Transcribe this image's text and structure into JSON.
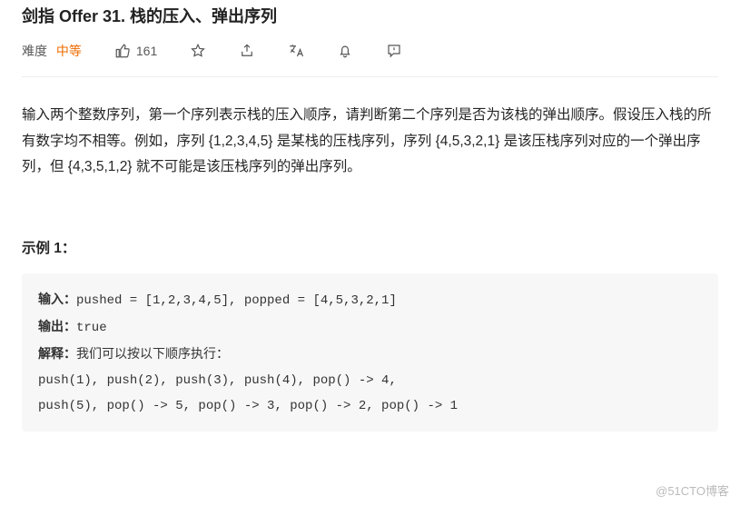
{
  "title": "剑指 Offer 31. 栈的压入、弹出序列",
  "meta": {
    "difficultyLabel": "难度",
    "difficultyValue": "中等",
    "likes": "161"
  },
  "description": "输入两个整数序列，第一个序列表示栈的压入顺序，请判断第二个序列是否为该栈的弹出顺序。假设压入栈的所有数字均不相等。例如，序列 {1,2,3,4,5} 是某栈的压栈序列，序列 {4,5,3,2,1} 是该压栈序列对应的一个弹出序列，但 {4,3,5,1,2} 就不可能是该压栈序列的弹出序列。",
  "example": {
    "heading": "示例 1：",
    "inputLabel": "输入：",
    "inputValue": "pushed = [1,2,3,4,5], popped = [4,5,3,2,1]",
    "outputLabel": "输出：",
    "outputValue": "true",
    "explainLabel": "解释：",
    "explainValue": "我们可以按以下顺序执行：",
    "rest": "push(1), push(2), push(3), push(4), pop() -> 4,\npush(5), pop() -> 5, pop() -> 3, pop() -> 2, pop() -> 1"
  },
  "watermark": "@51CTO博客"
}
